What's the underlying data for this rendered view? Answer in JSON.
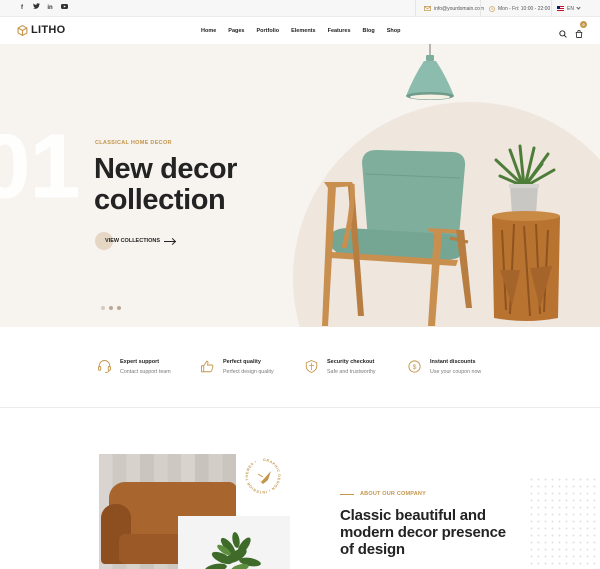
{
  "topbar": {
    "social": [
      "f",
      "t",
      "in",
      "yt"
    ],
    "email": "info@yourdomain.com",
    "hours": "Mon - Fri: 10:00 - 22:00",
    "language": "EN"
  },
  "header": {
    "logo": "LITHO",
    "nav": [
      "Home",
      "Pages",
      "Portfolio",
      "Elements",
      "Features",
      "Blog",
      "Shop"
    ],
    "cart_count": "0"
  },
  "hero": {
    "slide_number": "01",
    "eyebrow": "CLASSICAL HOME DECOR",
    "title": "New decor collection",
    "cta": "VIEW COLLECTIONS",
    "slides": 3,
    "active_slide": 2
  },
  "features": [
    {
      "icon": "headset-icon",
      "title": "Expert support",
      "subtitle": "Contact support team"
    },
    {
      "icon": "thumbs-up-icon",
      "title": "Perfect quality",
      "subtitle": "Perfect design quality"
    },
    {
      "icon": "shield-icon",
      "title": "Security checkout",
      "subtitle": "Safe and trustworthy"
    },
    {
      "icon": "dollar-coin-icon",
      "title": "Instant discounts",
      "subtitle": "Use your coupon now"
    }
  ],
  "about": {
    "eyebrow": "ABOUT OUR COMPANY",
    "title": "Classic beautiful and modern decor presence of design",
    "badge_text": "GRAPHIC DESIGN • INTERIOR THEMES •"
  },
  "colors": {
    "accent": "#c3964b",
    "hero_bg": "#f7f3ef",
    "chair_fabric": "#7fae9c",
    "lamp": "#8cbcae"
  }
}
